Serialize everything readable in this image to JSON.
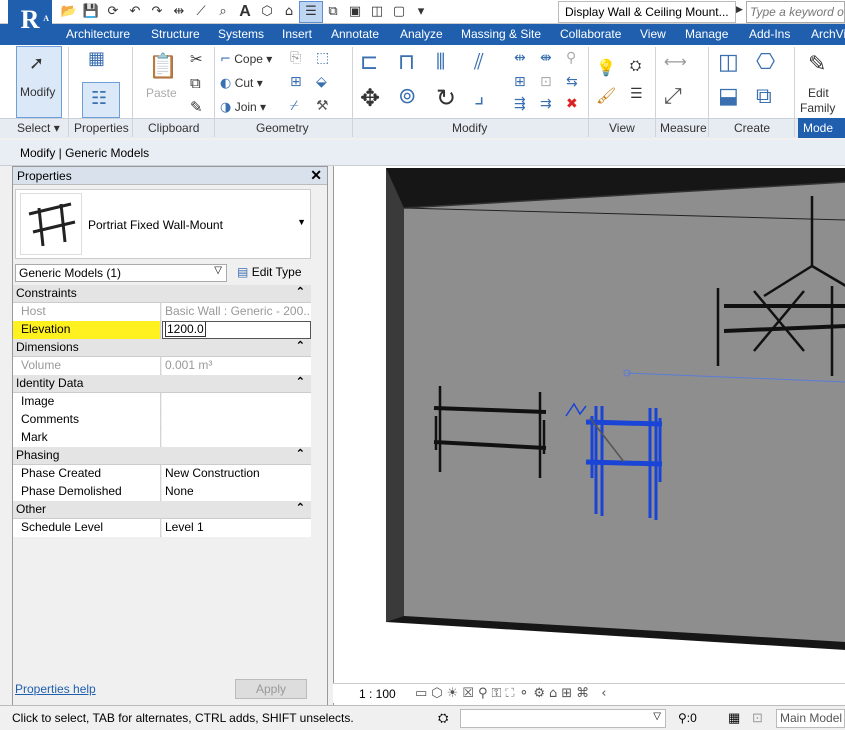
{
  "app": {
    "logo_letter": "R",
    "logo_sub": "A",
    "title": "Display Wall & Ceiling Mount...",
    "search_placeholder": "Type a keyword or p"
  },
  "tabs": [
    "Architecture",
    "Structure",
    "Systems",
    "Insert",
    "Annotate",
    "Analyze",
    "Massing & Site",
    "Collaborate",
    "View",
    "Manage",
    "Add-Ins",
    "ArchVi"
  ],
  "ribbon": {
    "modify_label": "Modify",
    "select_label": "Select",
    "properties_label": "Properties",
    "clipboard_label": "Clipboard",
    "paste_label": "Paste",
    "geometry_label": "Geometry",
    "cope_label": "Cope",
    "cut_label": "Cut",
    "join_label": "Join",
    "modify_panel_label": "Modify",
    "view_label": "View",
    "measure_label": "Measure",
    "create_label": "Create",
    "edit_family_l1": "Edit",
    "edit_family_l2": "Family",
    "mode_label": "Mode"
  },
  "option_bar": "Modify | Generic Models",
  "properties": {
    "title": "Properties",
    "type_name": "Portriat Fixed Wall-Mount",
    "filter": "Generic Models (1)",
    "edit_type": "Edit Type",
    "sections": {
      "constraints": "Constraints",
      "dimensions": "Dimensions",
      "identity": "Identity Data",
      "phasing": "Phasing",
      "other": "Other"
    },
    "host_k": "Host",
    "host_v": "Basic Wall : Generic - 200...",
    "elev_k": "Elevation",
    "elev_v": "1200.0",
    "vol_k": "Volume",
    "vol_v": "0.001 m³",
    "image_k": "Image",
    "comments_k": "Comments",
    "mark_k": "Mark",
    "pc_k": "Phase Created",
    "pc_v": "New Construction",
    "pd_k": "Phase Demolished",
    "pd_v": "None",
    "sl_k": "Schedule Level",
    "sl_v": "Level 1",
    "help": "Properties help",
    "apply": "Apply"
  },
  "view": {
    "scale": "1 : 100"
  },
  "status": {
    "message": "Click to select, TAB for alternates, CTRL adds, SHIFT unselects.",
    "count": ":0",
    "model": "Main Model"
  },
  "colors": {
    "brand": "#1f5fae",
    "selection": "#1a44d6",
    "highlight": "#fff01f"
  }
}
